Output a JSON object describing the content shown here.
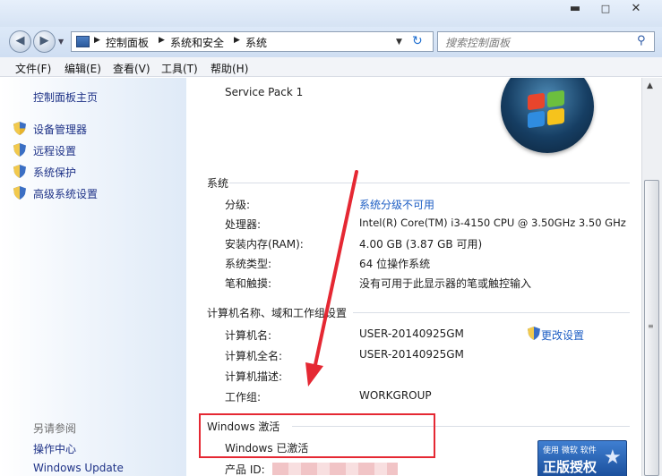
{
  "window": {
    "controls": {
      "minimize": "▬",
      "maximize": "□",
      "close": "✕"
    }
  },
  "navigation": {
    "back_icon": "◀",
    "forward_icon": "▶",
    "history_icon": "▼",
    "breadcrumbs": [
      "控制面板",
      "系统和安全",
      "系统"
    ],
    "refresh_icon": "↻",
    "search_placeholder": "搜索控制面板",
    "search_icon": "⚲"
  },
  "menu": [
    "文件(F)",
    "编辑(E)",
    "查看(V)",
    "工具(T)",
    "帮助(H)"
  ],
  "sidebar": {
    "home_link": "控制面板主页",
    "links": [
      "设备管理器",
      "远程设置",
      "系统保护",
      "高级系统设置"
    ],
    "see_also_heading": "另请参阅",
    "see_also_links": [
      "操作中心",
      "Windows Update"
    ]
  },
  "content": {
    "service_pack": "Service Pack 1",
    "system_section": {
      "title": "系统",
      "rows": [
        {
          "label": "分级:",
          "value": "系统分级不可用",
          "is_link": true
        },
        {
          "label": "处理器:",
          "value": "Intel(R) Core(TM) i3-4150 CPU @ 3.50GHz   3.50 GHz",
          "is_link": false
        },
        {
          "label": "安装内存(RAM):",
          "value": "4.00 GB (3.87 GB 可用)",
          "is_link": false
        },
        {
          "label": "系统类型:",
          "value": "64 位操作系统",
          "is_link": false
        },
        {
          "label": "笔和触摸:",
          "value": "没有可用于此显示器的笔或触控输入",
          "is_link": false
        }
      ]
    },
    "computer_section": {
      "title": "计算机名称、域和工作组设置",
      "rows": [
        {
          "label": "计算机名:",
          "value": "USER-20140925GM"
        },
        {
          "label": "计算机全名:",
          "value": "USER-20140925GM"
        },
        {
          "label": "计算机描述:",
          "value": ""
        },
        {
          "label": "工作组:",
          "value": "WORKGROUP"
        }
      ],
      "change_settings": "更改设置"
    },
    "activation_section": {
      "title": "Windows 激活",
      "status": "Windows 已激活",
      "product_id_label": "产品 ID:"
    },
    "genuine_badge": {
      "small_text": "使用 微软 软件",
      "big_text": "正版授权",
      "star": "★"
    }
  },
  "annotation_color": "#e52833",
  "link_color": "#1d5ec4"
}
